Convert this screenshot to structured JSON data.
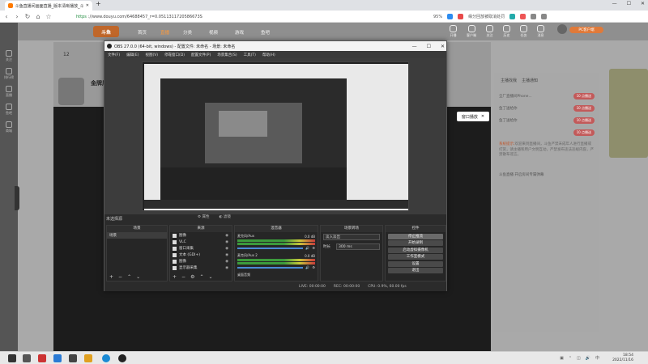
{
  "browser": {
    "tab_title": "斗鱼直播间画面直播_版本清晰播放_斗鱼",
    "new_tab": "+",
    "url_scheme": "https",
    "url_rest": "://www.douyu.com/64688457_r=0.0511311720586673S",
    "zoom": "95%",
    "search_hint": "缘分回放被取消处罚",
    "window_controls": [
      "—",
      "☐",
      "✕"
    ]
  },
  "douyu": {
    "logo": "斗鱼",
    "nav": [
      "首页",
      "直播",
      "分类",
      "视频",
      "游戏",
      "鱼吧"
    ],
    "top_icons": [
      "开播",
      "客户端",
      "关注",
      "历史",
      "任务",
      "消息"
    ],
    "client_button": "PC客户端",
    "level": "12",
    "anchor_name": "金牌厂...",
    "left_rail": [
      "关注",
      "排行榜",
      "直播",
      "鱼吧",
      "商城"
    ],
    "right_panel": {
      "tabs": [
        "主播找我",
        "主播通知"
      ],
      "rows": [
        {
          "label": "全厂直播间Phone...",
          "badge": "10 点播送"
        },
        {
          "label": "鱼丁送给你",
          "badge": "10 点播送"
        },
        {
          "label": "鱼丁送给你",
          "badge": "10 点播送"
        },
        {
          "label": "",
          "badge": "10 点播送"
        }
      ],
      "notice_prefix": "系统提示:",
      "notice": "欢迎来到直播间，斗鱼严禁未成年人进行直播或打赏，请主播和用户文明互动，严禁发布违法违规内容，严禁散布谣言。",
      "tip": "斗鱼直播 开启房间专属弹幕"
    }
  },
  "obs": {
    "title": "OBS 27.0.0 (64-bit, windows) - 配置文件: 未命名 - 场景: 未命名",
    "menu": [
      "文件(F)",
      "编辑(E)",
      "视图(V)",
      "停靠窗口(D)",
      "配置文件(P)",
      "场景集合(S)",
      "工具(T)",
      "帮助(H)"
    ],
    "scene_label": "未选择源",
    "preview_buttons": [
      "属性",
      "滤镜"
    ],
    "docks": {
      "scenes": {
        "title": "场景",
        "items": [
          "场景"
        ]
      },
      "sources": {
        "title": "来源",
        "items": [
          "图像",
          "VLC",
          "窗口采集",
          "文本 (GDI+)",
          "图像",
          "显示器采集"
        ]
      },
      "mixer": {
        "title": "混音器",
        "channels": [
          {
            "name": "麦克风/Aux",
            "db": "0.0 dB"
          },
          {
            "name": "麦克风/Aux 2",
            "db": "0.0 dB"
          }
        ]
      },
      "transitions": {
        "title": "场景转场",
        "type": "淡入淡出",
        "duration_label": "时长",
        "duration": "300 ms"
      },
      "controls": {
        "title": "控件",
        "buttons": [
          "停止推流",
          "开始录制",
          "启动虚拟摄像机",
          "工作室模式",
          "设置",
          "退出"
        ]
      }
    },
    "mixer_footer": "桌面音频",
    "status": {
      "live": "LIVE: 00:00:00",
      "rec": "REC: 00:00:00",
      "cpu": "CPU: 0.9%, 60.00 fps"
    }
  },
  "overlay_button": "窗口播放",
  "taskbar": {
    "time": "18:54",
    "date": "2022/11/16"
  }
}
